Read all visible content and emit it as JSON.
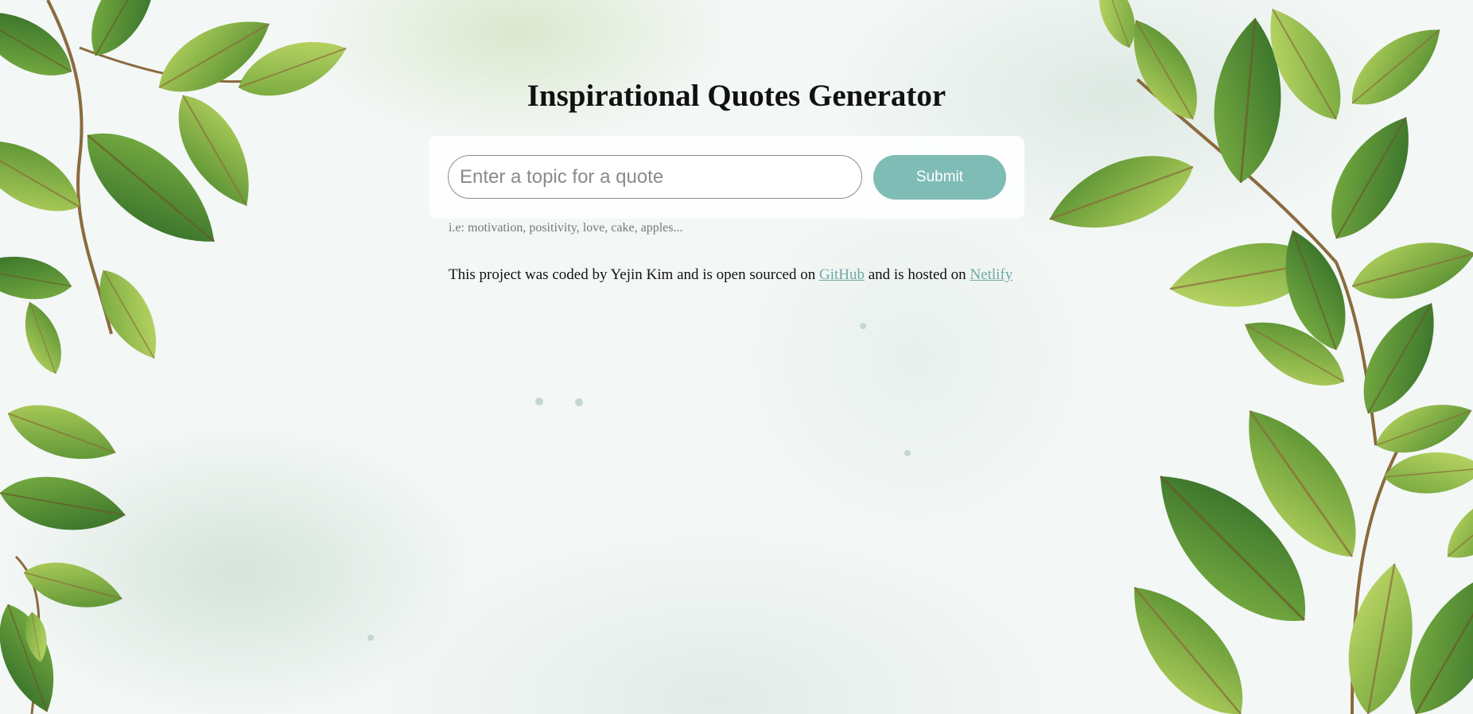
{
  "page": {
    "title": "Inspirational Quotes Generator"
  },
  "form": {
    "input_placeholder": "Enter a topic for a quote",
    "input_value": "",
    "submit_label": "Submit"
  },
  "hint": "i.e: motivation, positivity, love, cake, apples...",
  "footer": {
    "part1": "This project was coded by Yejin Kim and is open sourced on ",
    "github_label": "GitHub",
    "part2": " and is hosted on ",
    "netlify_label": "Netlify"
  },
  "colors": {
    "accent": "#7fbcb6",
    "link": "#6fa9a6",
    "leaf_dark": "#3f7a2c",
    "leaf_mid": "#6ea23a",
    "leaf_light": "#a9cc55"
  }
}
